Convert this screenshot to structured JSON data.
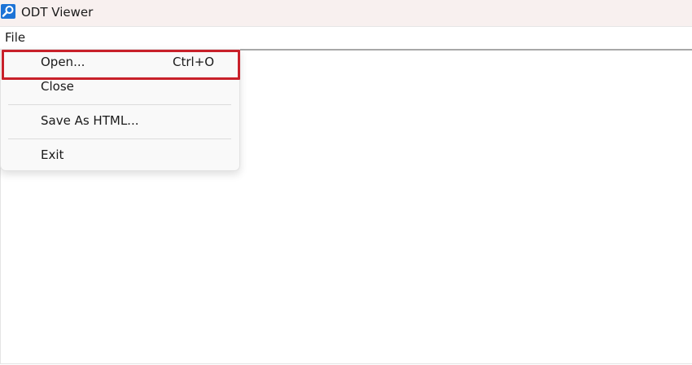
{
  "window": {
    "title": "ODT Viewer",
    "icon": "magnifier-app-icon"
  },
  "menubar": {
    "items": [
      {
        "label": "File"
      }
    ]
  },
  "file_menu": {
    "items": [
      {
        "label": "Open...",
        "shortcut": "Ctrl+O"
      },
      {
        "label": "Close"
      },
      {
        "label": "Save As HTML..."
      },
      {
        "label": "Exit"
      }
    ]
  },
  "annotation": {
    "highlight_color": "#c8202a",
    "highlighted_item": "Open..."
  },
  "colors": {
    "titlebar_bg": "#f8f0ef",
    "app_icon_bg": "#1d73d6",
    "menu_bg": "#f9f9f9"
  }
}
